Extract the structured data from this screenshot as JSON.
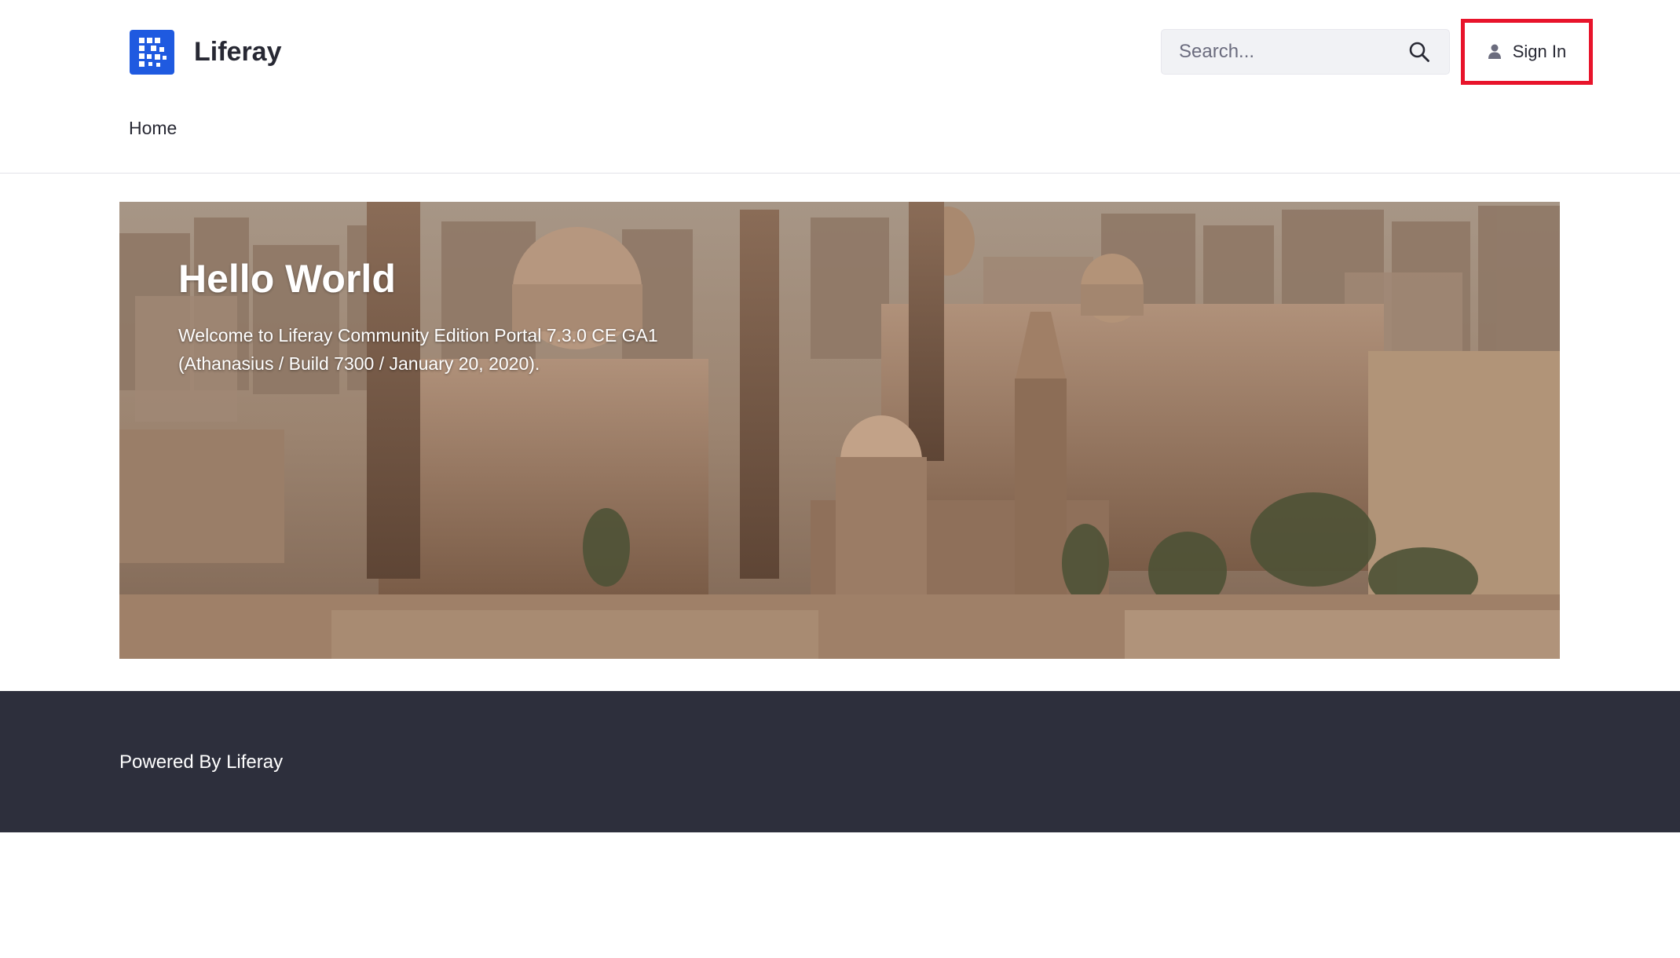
{
  "header": {
    "site_name": "Liferay",
    "search": {
      "placeholder": "Search..."
    },
    "sign_in_label": "Sign In",
    "icons": {
      "logo": "liferay-logo",
      "search": "search-icon",
      "user": "user-icon"
    }
  },
  "navigation": {
    "items": [
      {
        "label": "Home"
      }
    ]
  },
  "banner": {
    "title": "Hello World",
    "text_line1": "Welcome to Liferay Community Edition Portal 7.3.0 CE GA1",
    "text_line2": "(Athanasius / Build 7300 / January 20, 2020)."
  },
  "footer": {
    "powered_by": "Powered By",
    "link_label": "Liferay"
  },
  "colors": {
    "brand_blue": "#1f5ae0",
    "footer_bg": "#2d2f3c",
    "highlight_red": "#e8142b"
  }
}
